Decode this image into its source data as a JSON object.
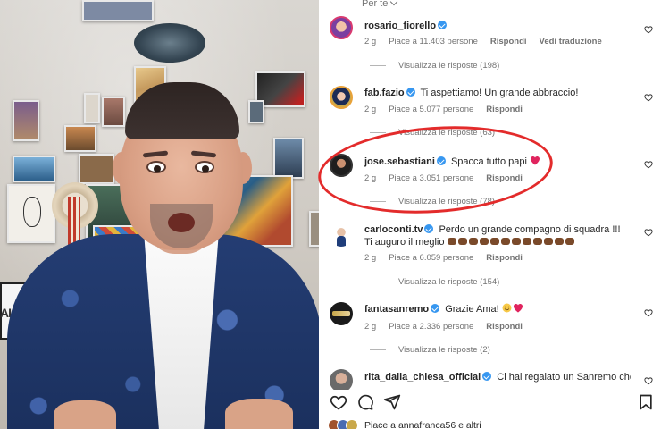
{
  "header": {
    "feed_label": "Per te",
    "chevron_icon": "chevron-down-icon"
  },
  "comments": [
    {
      "username": "rosario_fiorello",
      "verified": true,
      "text": "",
      "time": "2 g",
      "likes": "Piace a 11.403 persone",
      "reply": "Rispondi",
      "translate": "Vedi traduzione",
      "view_replies": "Visualizza le risposte (198)"
    },
    {
      "username": "fab.fazio",
      "verified": true,
      "text": "Ti aspettiamo! Un grande abbraccio!",
      "time": "2 g",
      "likes": "Piace a 5.077 persone",
      "reply": "Rispondi",
      "view_replies": "Visualizza le risposte (63)"
    },
    {
      "username": "jose.sebastiani",
      "verified": true,
      "text": "Spacca tutto papi",
      "time": "2 g",
      "likes": "Piace a 3.051 persone",
      "reply": "Rispondi",
      "view_replies": "Visualizza le risposte (78)"
    },
    {
      "username": "carloconti.tv",
      "verified": true,
      "text": "Perdo un grande compagno di squadra !!!",
      "text_line2": "Ti auguro il meglio",
      "time": "2 g",
      "likes": "Piace a 6.059 persone",
      "reply": "Rispondi",
      "view_replies": "Visualizza le risposte (154)"
    },
    {
      "username": "fantasanremo",
      "verified": true,
      "text": "Grazie Ama!",
      "time": "2 g",
      "likes": "Piace a 2.336 persone",
      "reply": "Rispondi",
      "view_replies": "Visualizza le risposte (2)"
    },
    {
      "username": "rita_dalla_chiesa_official",
      "verified": true,
      "text": "Ci hai regalato un Sanremo che"
    }
  ],
  "video": {
    "screen_text": "ALIN"
  },
  "footer": {
    "likes_text": "Piace a annafranca56 e altri"
  },
  "colors": {
    "verified": "#3797f0",
    "annotation": "#e32b2b",
    "muted": "#737373",
    "heart_red": "#e0245e"
  },
  "icons": [
    "heart-icon",
    "comment-icon",
    "share-icon",
    "bookmark-icon",
    "verified-badge-icon"
  ]
}
